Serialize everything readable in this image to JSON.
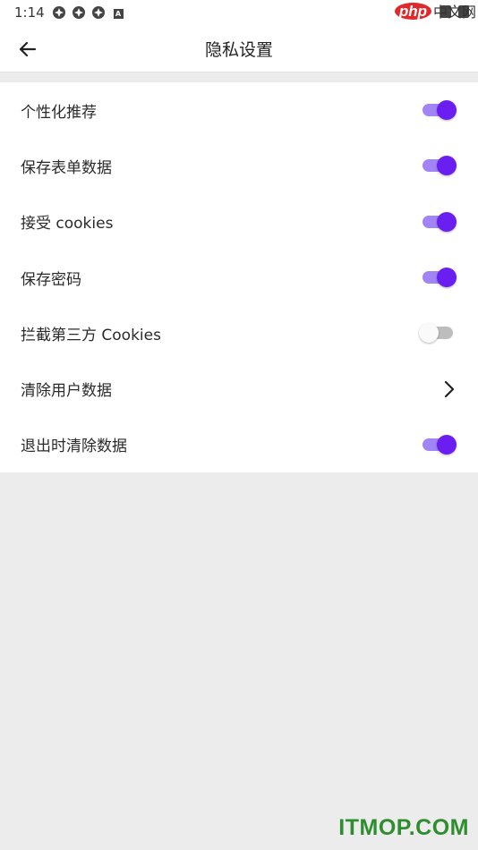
{
  "status_bar": {
    "time": "1:14",
    "icons": [
      "notification-icon",
      "notification-icon",
      "notification-icon",
      "a-icon"
    ]
  },
  "watermark_top": {
    "logo": "php",
    "text": "中文网"
  },
  "watermark_bottom": "ITMOP.COM",
  "app_bar": {
    "title": "隐私设置",
    "back_icon": "arrow-left-icon"
  },
  "colors": {
    "accent": "#6a1ff0",
    "accent_track": "#a185f7",
    "background": "#ececec"
  },
  "settings": [
    {
      "label": "个性化推荐",
      "control": "toggle",
      "on": true
    },
    {
      "label": "保存表单数据",
      "control": "toggle",
      "on": true
    },
    {
      "label": "接受 cookies",
      "control": "toggle",
      "on": true
    },
    {
      "label": "保存密码",
      "control": "toggle",
      "on": true
    },
    {
      "label": "拦截第三方 Cookies",
      "control": "toggle",
      "on": false
    },
    {
      "label": "清除用户数据",
      "control": "chevron"
    },
    {
      "label": "退出时清除数据",
      "control": "toggle",
      "on": true
    }
  ]
}
